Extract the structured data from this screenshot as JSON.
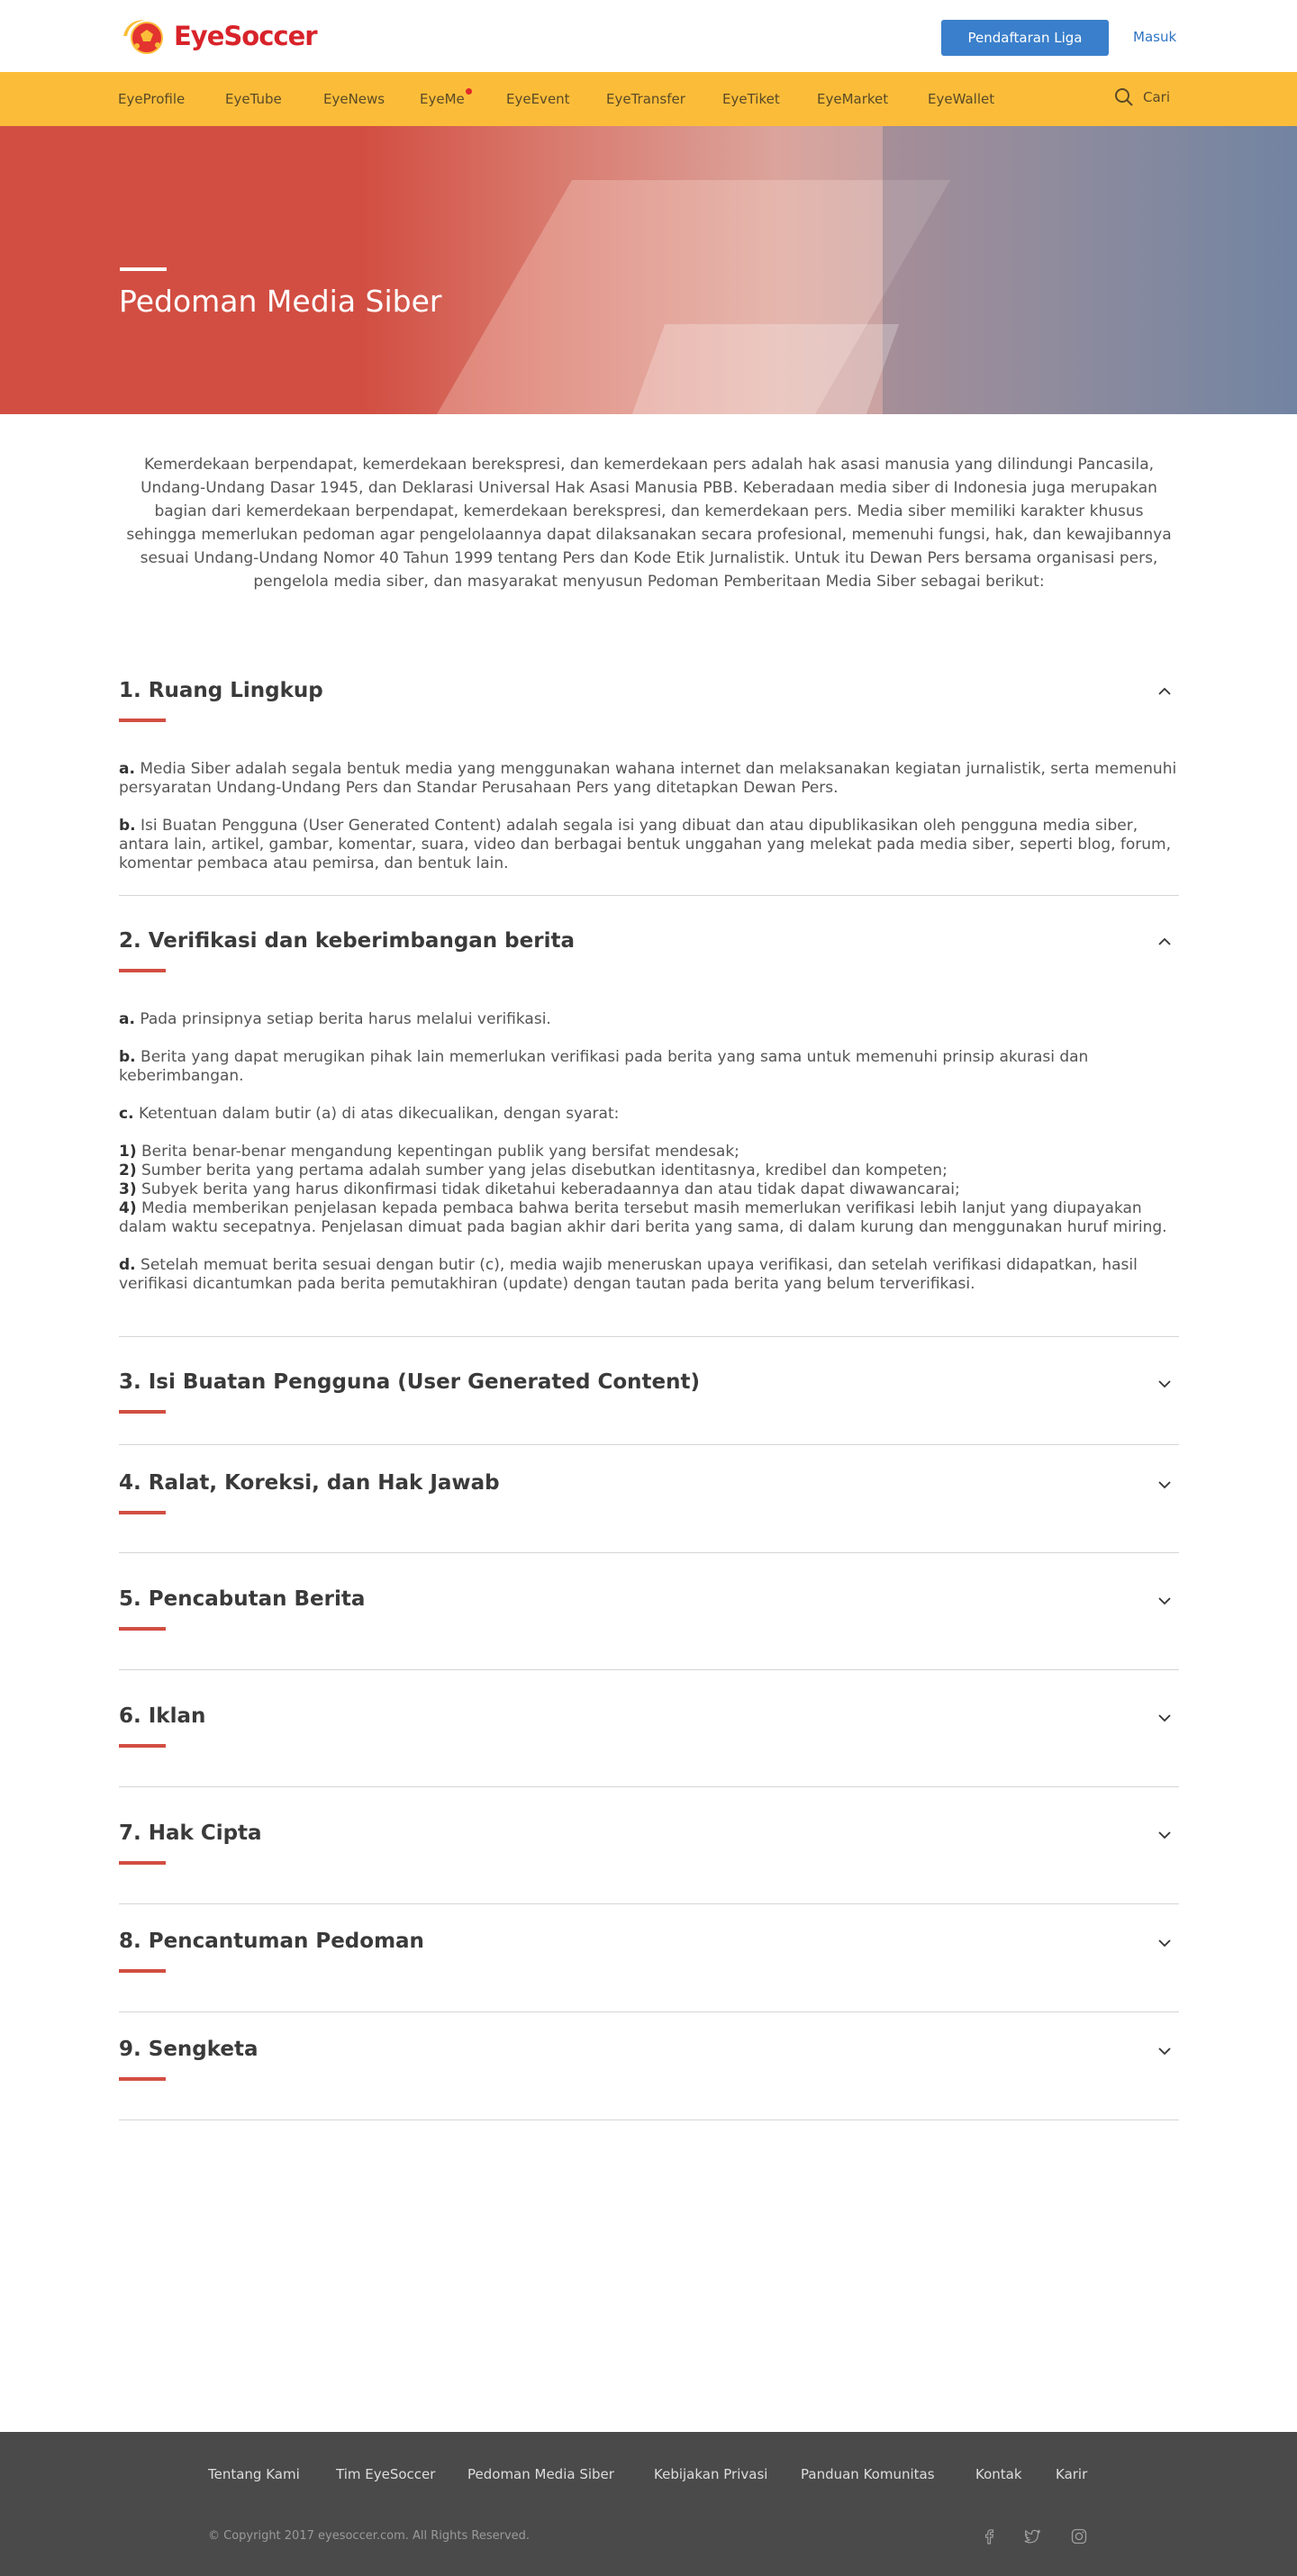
{
  "header": {
    "logo_text": "EyeSoccer",
    "register_label": "Pendaftaran Liga",
    "login_label": "Masuk"
  },
  "nav": {
    "items": [
      {
        "label": "EyeProfile"
      },
      {
        "label": "EyeTube"
      },
      {
        "label": "EyeNews"
      },
      {
        "label": "EyeMe"
      },
      {
        "label": "EyeEvent"
      },
      {
        "label": "EyeTransfer"
      },
      {
        "label": "EyeTiket"
      },
      {
        "label": "EyeMarket"
      },
      {
        "label": "EyeWallet"
      }
    ],
    "search_label": "Cari"
  },
  "hero": {
    "title": "Pedoman Media Siber"
  },
  "intro": "Kemerdekaan berpendapat, kemerdekaan berekspresi, dan kemerdekaan pers adalah hak asasi manusia yang dilindungi Pancasila, Undang-Undang Dasar 1945, dan Deklarasi Universal Hak Asasi Manusia PBB. Keberadaan media siber di Indonesia juga merupakan bagian dari kemerdekaan berpendapat, kemerdekaan berekspresi, dan kemerdekaan pers. Media siber memiliki karakter khusus sehingga memerlukan pedoman agar pengelolaannya dapat dilaksanakan secara profesional, memenuhi fungsi, hak, dan kewajibannya sesuai Undang-Undang Nomor 40 Tahun 1999 tentang Pers dan Kode Etik Jurnalistik. Untuk itu Dewan Pers bersama organisasi pers, pengelola media siber, dan masyarakat menyusun Pedoman Pemberitaan Media Siber sebagai berikut:",
  "sections": [
    {
      "title": "1. Ruang Lingkup",
      "expanded": true,
      "items": [
        {
          "marker": "a.",
          "text": " Media Siber adalah segala bentuk media yang menggunakan wahana internet dan melaksanakan kegiatan jurnalistik, serta memenuhi persyaratan Undang-Undang Pers dan Standar Perusahaan Pers yang ditetapkan Dewan Pers."
        },
        {
          "marker": "b.",
          "text": " Isi Buatan Pengguna (User Generated Content) adalah segala isi yang dibuat dan atau dipublikasikan oleh pengguna media siber, antara lain, artikel, gambar, komentar, suara, video dan berbagai bentuk unggahan yang melekat pada media siber, seperti blog, forum, komentar pembaca atau pemirsa, dan bentuk lain."
        }
      ]
    },
    {
      "title": "2. Verifikasi dan keberimbangan berita",
      "expanded": true,
      "items": [
        {
          "marker": "a.",
          "text": " Pada prinsipnya setiap berita harus melalui verifikasi."
        },
        {
          "marker": "b.",
          "text": " Berita yang dapat merugikan pihak lain memerlukan verifikasi pada berita yang sama untuk memenuhi prinsip akurasi dan keberimbangan."
        },
        {
          "marker": "c.",
          "text": " Ketentuan dalam butir (a) di atas dikecualikan, dengan syarat:"
        }
      ],
      "subitems": [
        {
          "marker": "1)",
          "text": " Berita benar-benar mengandung kepentingan publik yang bersifat mendesak;"
        },
        {
          "marker": "2)",
          "text": " Sumber berita yang pertama adalah sumber yang jelas disebutkan identitasnya, kredibel dan kompeten;"
        },
        {
          "marker": "3)",
          "text": " Subyek berita yang harus dikonfirmasi tidak diketahui keberadaannya dan atau tidak dapat diwawancarai;"
        },
        {
          "marker": "4)",
          "text": " Media memberikan penjelasan kepada pembaca bahwa berita tersebut masih memerlukan verifikasi lebih lanjut yang diupayakan dalam waktu secepatnya. Penjelasan dimuat pada bagian akhir dari berita yang sama, di dalam kurung dan menggunakan huruf miring."
        }
      ],
      "final_item": {
        "marker": "d.",
        "text": " Setelah memuat berita sesuai dengan butir (c), media wajib meneruskan upaya verifikasi, dan setelah verifikasi didapatkan, hasil verifikasi dicantumkan pada berita pemutakhiran (update) dengan tautan pada berita yang belum terverifikasi."
      }
    },
    {
      "title": "3. Isi Buatan Pengguna (User Generated Content)",
      "expanded": false
    },
    {
      "title": "4. Ralat, Koreksi, dan Hak Jawab",
      "expanded": false
    },
    {
      "title": "5. Pencabutan Berita",
      "expanded": false
    },
    {
      "title": "6. Iklan",
      "expanded": false
    },
    {
      "title": "7. Hak Cipta",
      "expanded": false
    },
    {
      "title": "8. Pencantuman Pedoman",
      "expanded": false
    },
    {
      "title": "9. Sengketa",
      "expanded": false
    }
  ],
  "footer": {
    "links": [
      {
        "label": "Tentang Kami"
      },
      {
        "label": "Tim EyeSoccer"
      },
      {
        "label": "Pedoman Media Siber"
      },
      {
        "label": "Kebijakan Privasi"
      },
      {
        "label": "Panduan Komunitas"
      },
      {
        "label": "Kontak"
      },
      {
        "label": "Karir"
      }
    ],
    "copyright": "© Copyright 2017 eyesoccer.com. All Rights Reserved."
  },
  "icons": {
    "search": "search-icon",
    "chevron_up": "chevron-up-icon",
    "chevron_down": "chevron-down-icon",
    "facebook": "facebook-icon",
    "twitter": "twitter-icon",
    "instagram": "instagram-icon"
  },
  "colors": {
    "accent_red": "#d24e42",
    "nav_yellow": "#fbbd39",
    "button_blue": "#3a7fcb",
    "footer_bg": "#4a4a4a"
  }
}
